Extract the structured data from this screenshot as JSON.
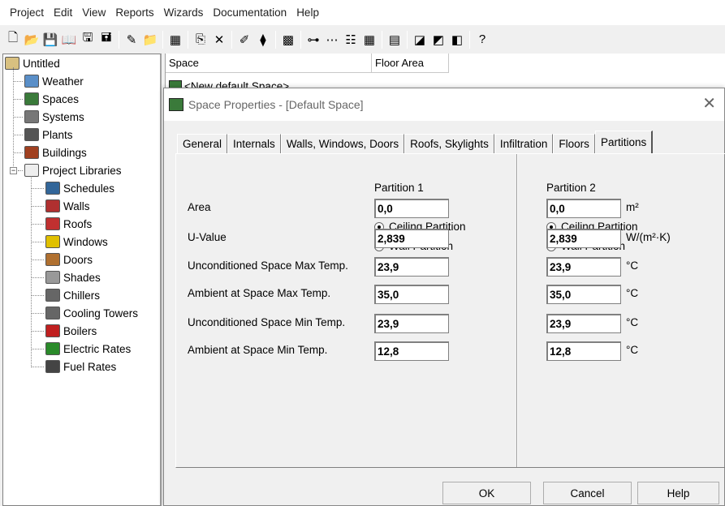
{
  "menu": [
    "Project",
    "Edit",
    "View",
    "Reports",
    "Wizards",
    "Documentation",
    "Help"
  ],
  "toolbar": {
    "groups": [
      [
        {
          "icon": "new-icon",
          "glyph": "🗋"
        },
        {
          "icon": "open-icon",
          "glyph": "📂"
        },
        {
          "icon": "save-icon",
          "glyph": "💾"
        },
        {
          "icon": "book-icon",
          "glyph": "📖"
        },
        {
          "icon": "save-as-icon",
          "glyph": "🖫"
        },
        {
          "icon": "save-all-icon",
          "glyph": "🖬"
        }
      ],
      [
        {
          "icon": "wizard-icon",
          "glyph": "✎"
        },
        {
          "icon": "folder-arrow-icon",
          "glyph": "📁"
        }
      ],
      [
        {
          "icon": "building-icon",
          "glyph": "▦"
        }
      ],
      [
        {
          "icon": "copy-icon",
          "glyph": "⎘"
        },
        {
          "icon": "delete-icon",
          "glyph": "✕"
        }
      ],
      [
        {
          "icon": "edit-icon",
          "glyph": "✐"
        },
        {
          "icon": "pin-icon",
          "glyph": "⧫"
        }
      ],
      [
        {
          "icon": "chart-icon",
          "glyph": "▩"
        }
      ],
      [
        {
          "icon": "tree-view-icon",
          "glyph": "⊶"
        },
        {
          "icon": "connect-icon",
          "glyph": "⋯"
        },
        {
          "icon": "list-view-icon",
          "glyph": "☷"
        },
        {
          "icon": "grid-view-icon",
          "glyph": "▦"
        }
      ],
      [
        {
          "icon": "calculator-icon",
          "glyph": "▤"
        }
      ],
      [
        {
          "icon": "report-icon",
          "glyph": "◪"
        },
        {
          "icon": "chart-edit-icon",
          "glyph": "◩"
        },
        {
          "icon": "chart-save-icon",
          "glyph": "◧"
        }
      ],
      [
        {
          "icon": "help-icon",
          "glyph": "?"
        }
      ]
    ]
  },
  "tree": {
    "root": "Untitled",
    "items": [
      {
        "label": "Weather",
        "icon": "weather-icon",
        "color": "#5a8fc8"
      },
      {
        "label": "Spaces",
        "icon": "spaces-icon",
        "color": "#3a7a3a"
      },
      {
        "label": "Systems",
        "icon": "systems-icon",
        "color": "#777777"
      },
      {
        "label": "Plants",
        "icon": "plants-icon",
        "color": "#555555"
      },
      {
        "label": "Buildings",
        "icon": "buildings-icon",
        "color": "#a04020"
      }
    ],
    "libraries": {
      "label": "Project Libraries",
      "items": [
        {
          "label": "Schedules",
          "icon": "schedules-icon",
          "color": "#336699"
        },
        {
          "label": "Walls",
          "icon": "walls-icon",
          "color": "#b03030"
        },
        {
          "label": "Roofs",
          "icon": "roofs-icon",
          "color": "#c03030"
        },
        {
          "label": "Windows",
          "icon": "windows-icon",
          "color": "#e0c000"
        },
        {
          "label": "Doors",
          "icon": "doors-icon",
          "color": "#b07030"
        },
        {
          "label": "Shades",
          "icon": "shades-icon",
          "color": "#999999"
        },
        {
          "label": "Chillers",
          "icon": "chillers-icon",
          "color": "#666666"
        },
        {
          "label": "Cooling Towers",
          "icon": "cooling-towers-icon",
          "color": "#666666"
        },
        {
          "label": "Boilers",
          "icon": "boilers-icon",
          "color": "#c02020"
        },
        {
          "label": "Electric Rates",
          "icon": "electric-rates-icon",
          "color": "#2a8a2a"
        },
        {
          "label": "Fuel Rates",
          "icon": "fuel-rates-icon",
          "color": "#444444"
        }
      ]
    }
  },
  "list": {
    "columns": [
      "Space",
      "Floor Area"
    ],
    "rows": [
      "<New default Space>"
    ]
  },
  "dialog": {
    "title": "Space Properties - [Default Space]",
    "tabs": [
      "General",
      "Internals",
      "Walls, Windows, Doors",
      "Roofs, Skylights",
      "Infiltration",
      "Floors",
      "Partitions"
    ],
    "active_tab": "Partitions",
    "partition1_heading": "Partition 1",
    "partition2_heading": "Partition 2",
    "ceiling_label": "Ceiling Partition",
    "wall_label": "Wall Partition",
    "rows": [
      {
        "label": "Area",
        "p1": "0,0",
        "p2": "0,0",
        "unit": "m²"
      },
      {
        "label": "U-Value",
        "p1": "2,839",
        "p2": "2,839",
        "unit": "W/(m²·K)"
      },
      {
        "label": "Unconditioned Space Max Temp.",
        "p1": "23,9",
        "p2": "23,9",
        "unit": "°C"
      },
      {
        "label": "Ambient at Space Max Temp.",
        "p1": "35,0",
        "p2": "35,0",
        "unit": "°C"
      },
      {
        "label": "Unconditioned Space Min Temp.",
        "p1": "23,9",
        "p2": "23,9",
        "unit": "°C"
      },
      {
        "label": "Ambient at Space Min Temp.",
        "p1": "12,8",
        "p2": "12,8",
        "unit": "°C"
      }
    ],
    "buttons": {
      "ok": "OK",
      "cancel": "Cancel",
      "help": "Help"
    }
  }
}
